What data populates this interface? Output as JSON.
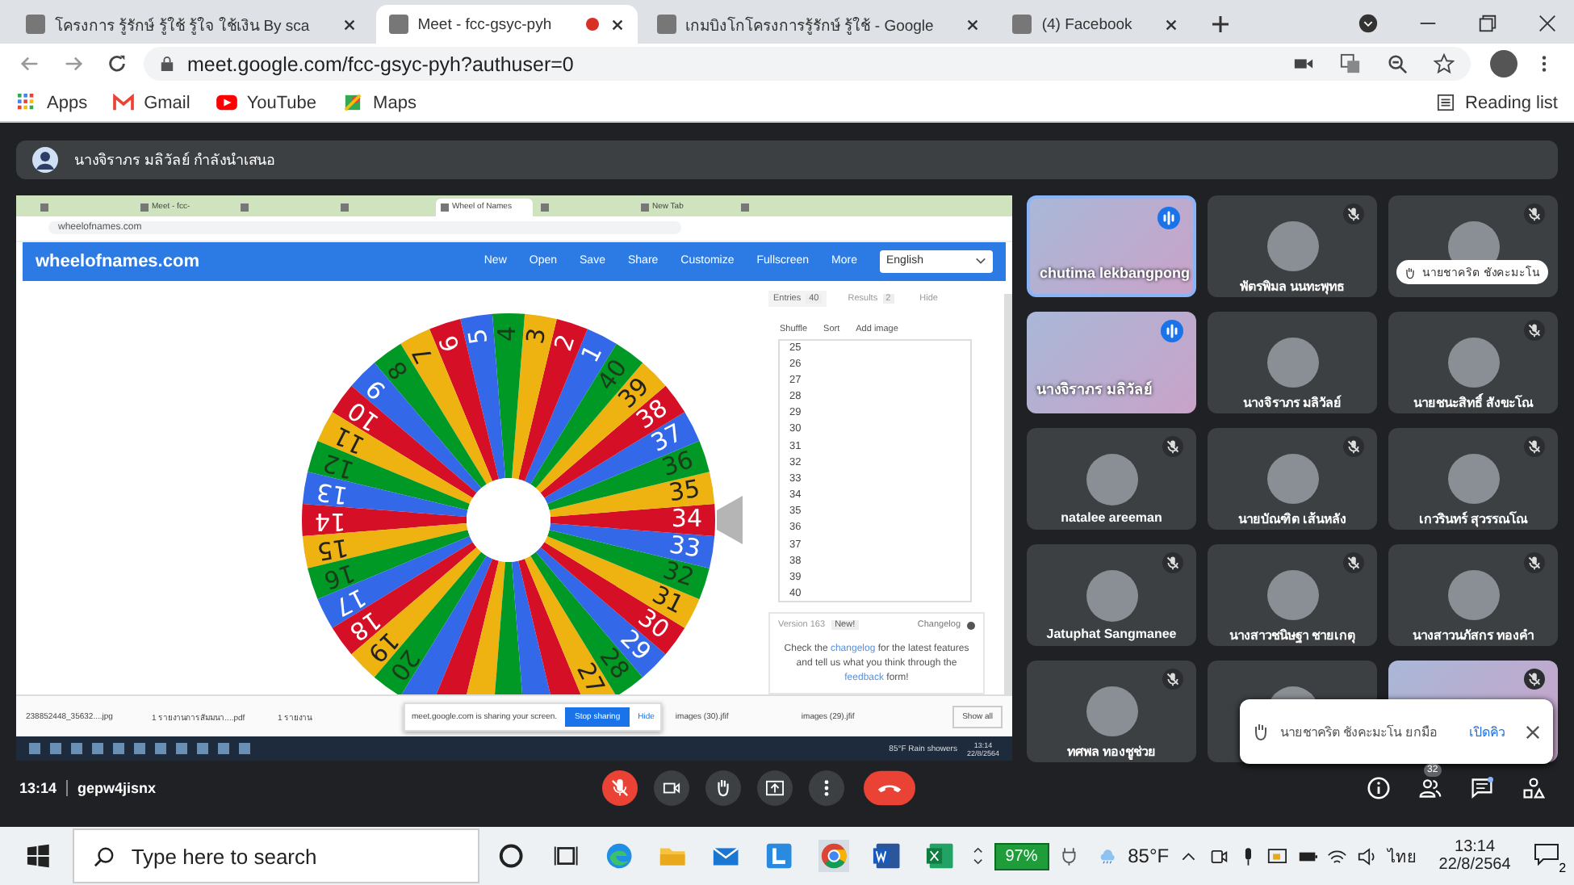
{
  "browser": {
    "tabs": [
      {
        "title": "โครงการ รู้รักษ์ รู้ใช้ รู้ใจ ใช้เงิน By sca",
        "selected": false,
        "recording": false
      },
      {
        "title": "Meet - fcc-gsyc-pyh",
        "selected": true,
        "recording": true
      },
      {
        "title": "เกมบิงโกโครงการรู้รักษ์ รู้ใช้ - Google",
        "selected": false,
        "recording": false
      },
      {
        "title": "(4) Facebook",
        "selected": false,
        "recording": false
      }
    ],
    "url": "meet.google.com/fcc-gsyc-pyh?authuser=0",
    "bookmarks": [
      "Apps",
      "Gmail",
      "YouTube",
      "Maps"
    ],
    "reading_list": "Reading list"
  },
  "meet": {
    "presenter_banner": "นางจิราภร มลิวัลย์ กำลังนำเสนอ",
    "shared_screen": {
      "tabs": [
        {
          "selected": false
        },
        {
          "title": "Meet - fcc-",
          "selected": false
        },
        {
          "selected": false
        },
        {
          "selected": false
        },
        {
          "title": "Wheel of Names",
          "selected": true
        },
        {
          "selected": false
        },
        {
          "title": "New Tab",
          "selected": false
        },
        {
          "selected": false
        }
      ],
      "url": "wheelofnames.com",
      "site_title": "wheelofnames.com",
      "toolbar": [
        "New",
        "Open",
        "Save",
        "Share",
        "Customize",
        "Fullscreen",
        "More"
      ],
      "language": "English",
      "wheel": [
        {
          "label": "1",
          "color": "#3369e8"
        },
        {
          "label": "2",
          "color": "#d50f25"
        },
        {
          "label": "3",
          "color": "#eeb211"
        },
        {
          "label": "4",
          "color": "#009925"
        },
        {
          "label": "5",
          "color": "#3369e8"
        },
        {
          "label": "6",
          "color": "#d50f25"
        },
        {
          "label": "7",
          "color": "#eeb211"
        },
        {
          "label": "8",
          "color": "#009925"
        },
        {
          "label": "9",
          "color": "#3369e8"
        },
        {
          "label": "10",
          "color": "#d50f25"
        },
        {
          "label": "11",
          "color": "#eeb211"
        },
        {
          "label": "12",
          "color": "#009925"
        },
        {
          "label": "13",
          "color": "#3369e8"
        },
        {
          "label": "14",
          "color": "#d50f25"
        },
        {
          "label": "15",
          "color": "#eeb211"
        },
        {
          "label": "16",
          "color": "#009925"
        },
        {
          "label": "17",
          "color": "#3369e8"
        },
        {
          "label": "18",
          "color": "#d50f25"
        },
        {
          "label": "19",
          "color": "#eeb211"
        },
        {
          "label": "20",
          "color": "#009925"
        },
        {
          "color": "#3369e8"
        },
        {
          "color": "#d50f25"
        },
        {
          "color": "#eeb211"
        },
        {
          "color": "#009925"
        },
        {
          "color": "#3369e8"
        },
        {
          "color": "#d50f25"
        },
        {
          "label": "27",
          "color": "#eeb211"
        },
        {
          "label": "28",
          "color": "#009925"
        },
        {
          "label": "29",
          "color": "#3369e8"
        },
        {
          "label": "30",
          "color": "#d50f25"
        },
        {
          "label": "31",
          "color": "#eeb211"
        },
        {
          "label": "32",
          "color": "#009925"
        },
        {
          "label": "33",
          "color": "#3369e8"
        },
        {
          "label": "34",
          "color": "#d50f25"
        },
        {
          "label": "35",
          "color": "#eeb211"
        },
        {
          "label": "36",
          "color": "#009925"
        },
        {
          "label": "37",
          "color": "#3369e8"
        },
        {
          "label": "38",
          "color": "#d50f25"
        },
        {
          "label": "39",
          "color": "#eeb211"
        },
        {
          "label": "40",
          "color": "#009925"
        }
      ],
      "sidebar_tabs": [
        {
          "label": "Entries",
          "count": "40",
          "selected": true
        },
        {
          "label": "Results",
          "count": "2",
          "selected": false
        },
        {
          "label": "Hide",
          "selected": false
        }
      ],
      "entry_actions": [
        "Shuffle",
        "Sort",
        "Add image"
      ],
      "entries": [
        "25",
        "26",
        "27",
        "28",
        "29",
        "30",
        "31",
        "32",
        "33",
        "34",
        "35",
        "36",
        "37",
        "38",
        "39",
        "40"
      ],
      "version": "Version 163",
      "version_badge": "New!",
      "changelog": "Changelog",
      "notice": [
        {
          "kind": "text",
          "text": "Check the "
        },
        {
          "kind": "link",
          "text": "changelog"
        },
        {
          "kind": "text",
          "text": " for the latest features and tell us what you think through the "
        },
        {
          "kind": "link",
          "text": "feedback"
        },
        {
          "kind": "text",
          "text": " form!"
        }
      ],
      "downloads": [
        "238852448_35632....jpg",
        "1 รายงานการสัมมนา....pdf",
        "1 รายงาน"
      ],
      "sharing_notice": "meet.google.com is sharing your screen.",
      "stop_sharing": "Stop sharing",
      "hide": "Hide",
      "downloads_right": [
        "images (30).jfif",
        "images (29).jfif"
      ],
      "show_all": "Show all",
      "weather": "85°F  Rain showers",
      "clock_time": "13:14",
      "clock_date": "22/8/2564"
    },
    "tiles": [
      {
        "kind": "video",
        "name": "chutima lekbangpong",
        "muted": false,
        "speaking": true,
        "highlighted": true
      },
      {
        "kind": "avatar",
        "name": "พัตรพิมล นนทะพุทธ",
        "muted": true,
        "speaking": false,
        "highlighted": false
      },
      {
        "kind": "avatar",
        "hand": "นายชาคริต ชังคะมะโน",
        "muted": true,
        "speaking": false,
        "highlighted": false
      },
      {
        "kind": "video",
        "name": "นางจิราภร มลิวัลย์",
        "muted": false,
        "speaking": true,
        "highlighted": false
      },
      {
        "kind": "avatar",
        "name": "นางจิราภร มลิวัลย์",
        "muted": false,
        "speaking": false,
        "highlighted": false
      },
      {
        "kind": "avatar",
        "name": "นายชนะสิทธิ์ สังขะโณ",
        "muted": true,
        "speaking": false,
        "highlighted": false
      },
      {
        "kind": "avatar",
        "name": "natalee areeman",
        "muted": true,
        "speaking": false,
        "highlighted": false
      },
      {
        "kind": "avatar",
        "name": "นายบัณฑิต เส้นหลัง",
        "muted": true,
        "speaking": false,
        "highlighted": false
      },
      {
        "kind": "avatar",
        "name": "เกวรินทร์ สุวรรณโณ",
        "muted": true,
        "speaking": false,
        "highlighted": false
      },
      {
        "kind": "avatar",
        "name": "Jatuphat Sangmanee",
        "muted": true,
        "speaking": false,
        "highlighted": false
      },
      {
        "kind": "avatar",
        "name": "นางสาวชนิษฐา ชายเกตุ",
        "muted": true,
        "speaking": false,
        "highlighted": false
      },
      {
        "kind": "avatar",
        "name": "นางสาวนภัสกร ทองคำ",
        "muted": true,
        "speaking": false,
        "highlighted": false
      },
      {
        "kind": "avatar",
        "name": "ทศพล ทองชูช่วย",
        "muted": true,
        "speaking": false,
        "highlighted": false
      },
      {
        "kind": "avatar",
        "muted": false,
        "speaking": false,
        "highlighted": false
      },
      {
        "kind": "video",
        "muted": true,
        "speaking": false,
        "highlighted": false
      }
    ],
    "toast": {
      "text": "นายชาคริต ชังคะมะโน ยกมือ",
      "action": "เปิดคิว"
    },
    "time": "13:14",
    "meeting_code": "gepw4jisnx",
    "mic_muted": true,
    "participants": "32"
  },
  "taskbar": {
    "search_placeholder": "Type here to search",
    "battery": "97%",
    "temperature": "85°F",
    "language": "ไทย",
    "time": "13:14",
    "date": "22/8/2564",
    "notifications": "2"
  }
}
